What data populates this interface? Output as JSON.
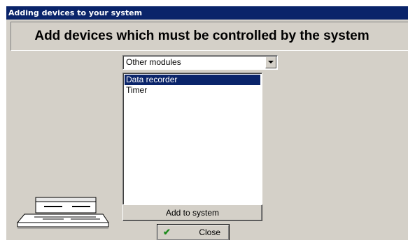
{
  "window": {
    "title": "Adding devices to your system"
  },
  "header": {
    "text": "Add devices which must be controlled by the system"
  },
  "category_select": {
    "value": "Other modules"
  },
  "device_list": {
    "items": [
      {
        "label": "Data recorder",
        "selected": true
      },
      {
        "label": "Timer",
        "selected": false
      }
    ]
  },
  "buttons": {
    "add_label": "Add to system",
    "close_label": "Close"
  },
  "icons": {
    "device": "recorder-device-icon",
    "close": "checkmark-icon"
  },
  "colors": {
    "titlebar": "#0a246a",
    "selection": "#0a246a",
    "window_bg": "#d4d0c8",
    "check": "#1a8a1a"
  }
}
